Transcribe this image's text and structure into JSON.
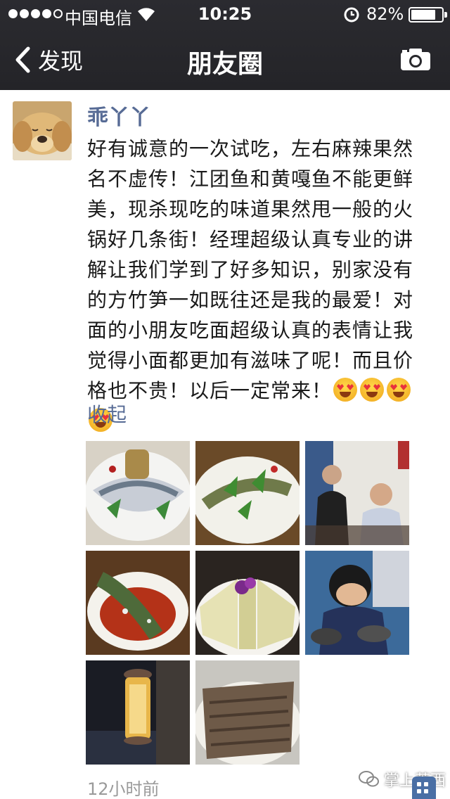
{
  "status_bar": {
    "carrier": "中国电信",
    "time": "10:25",
    "battery_percent": "82%",
    "battery_level": 0.82,
    "signal_bars_filled": 4,
    "signal_bars_total": 5
  },
  "nav": {
    "back_label": "发现",
    "title": "朋友圈",
    "back_icon": "chevron-left-icon",
    "action_icon": "camera-icon"
  },
  "post": {
    "username": "乖丫丫",
    "text": "好有诚意的一次试吃，左右麻辣果然名不虚传！江团鱼和黄嘎鱼不能更鲜美，现杀现吃的味道果然甩一般的火锅好几条街！经理超级认真专业的讲解让我们学到了好多知识，别家没有的方竹笋一如既往还是我的最爱！对面的小朋友吃面超级认真的表情让我觉得小面都更加有滋味了呢！而且价格也不贵！以后一定常来！",
    "emoji_icon": "heart-eyes-emoji-icon",
    "emoji_count": 4,
    "collapse_label": "收起",
    "timestamp": "12小时前",
    "photos": [
      {
        "name": "fish-slices-platter"
      },
      {
        "name": "fish-with-greens-plate"
      },
      {
        "name": "diners-at-table"
      },
      {
        "name": "spicy-fish-dish"
      },
      {
        "name": "bamboo-shoot-platter"
      },
      {
        "name": "child-eating-noodles"
      },
      {
        "name": "lantern-night-scene"
      },
      {
        "name": "tripe-slices-plate"
      }
    ]
  },
  "watermark": {
    "label": "掌上莱西",
    "icon": "wechat-icon"
  },
  "colors": {
    "link": "#576b95",
    "nav_bg": "#28282c",
    "text": "#1a1a1a",
    "meta": "#9a9a9a"
  }
}
